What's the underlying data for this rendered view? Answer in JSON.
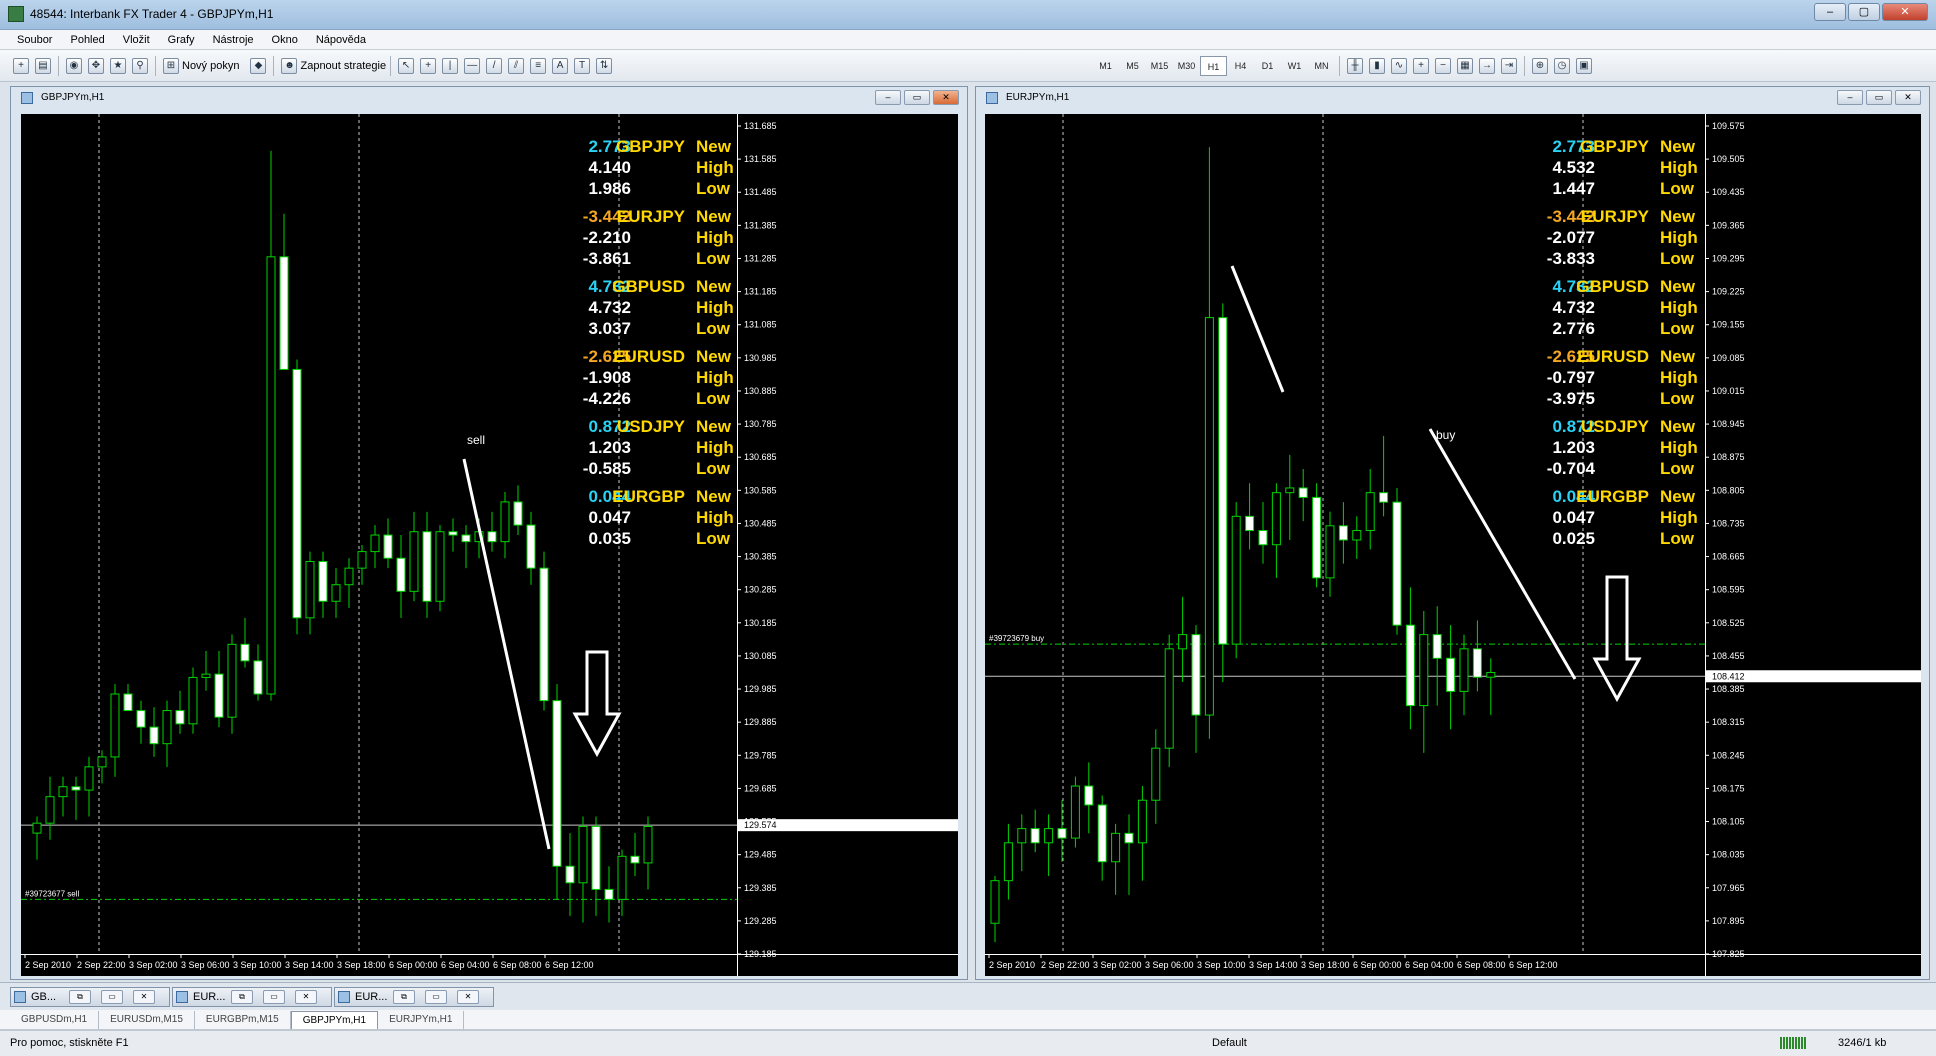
{
  "window": {
    "title": "48544: Interbank FX Trader 4 - GBPJPYm,H1",
    "min": "–",
    "max": "▢",
    "close": "✕"
  },
  "menu": [
    "Soubor",
    "Pohled",
    "Vložit",
    "Grafy",
    "Nástroje",
    "Okno",
    "Nápověda"
  ],
  "toolbar": {
    "new_order": "Nový pokyn",
    "expert": "Zapnout strategie",
    "timeframes": [
      "M1",
      "M5",
      "M15",
      "M30",
      "H1",
      "H4",
      "D1",
      "W1",
      "MN"
    ],
    "letter_tools": [
      "A",
      "T"
    ]
  },
  "icons": [
    "new-chart-icon",
    "profiles-icon",
    "market-watch-icon",
    "navigator-icon",
    "terminal-icon",
    "tester-icon",
    "new-order-icon",
    "expert-icon",
    "cursor-icon",
    "crosshair-icon",
    "vertical-line-icon",
    "horizontal-line-icon",
    "trendline-icon",
    "channel-icon",
    "fibonacci-icon",
    "text-icon",
    "label-icon",
    "arrows-icon",
    "bar-chart-icon",
    "candle-chart-icon",
    "line-chart-icon",
    "zoom-in-icon",
    "zoom-out-icon",
    "tile-icon",
    "autoscroll-icon",
    "shift-icon",
    "indicators-icon",
    "periods-icon",
    "templates-icon"
  ],
  "colors": {
    "bull": "#00d400",
    "bull_body": "#000000",
    "bear_body": "#ffffff",
    "grid": "#c8c8c8",
    "indicator_pos": "#29d3f5",
    "indicator_neg": "#f5a623",
    "symbol": "#ffd800",
    "row_white": "#ffffff"
  },
  "chart_windows": [
    {
      "title": "GBPJPYm,H1",
      "order_label": "#39723677 sell",
      "annotation": "sell",
      "current_price": "129.574",
      "indicator": [
        {
          "symbol": "GBPJPY",
          "new": "2.773",
          "high": "4.140",
          "low": "1.986",
          "new_positive": true
        },
        {
          "symbol": "EURJPY",
          "new": "-3.442",
          "high": "-2.210",
          "low": "-3.861",
          "new_positive": false
        },
        {
          "symbol": "GBPUSD",
          "new": "4.732",
          "high": "4.732",
          "low": "3.037",
          "new_positive": true
        },
        {
          "symbol": "EURUSD",
          "new": "-2.625",
          "high": "-1.908",
          "low": "-4.226",
          "new_positive": false
        },
        {
          "symbol": "USDJPY",
          "new": "0.872",
          "high": "1.203",
          "low": "-0.585",
          "new_positive": true
        },
        {
          "symbol": "EURGBP",
          "new": "0.044",
          "high": "0.047",
          "low": "0.035",
          "new_positive": true
        }
      ],
      "labels": {
        "new": "New",
        "high": "High",
        "low": "Low"
      },
      "chart_data": {
        "type": "candlestick",
        "symbol": "GBPJPYm",
        "timeframe": "H1",
        "ylim": [
          129.185,
          131.685
        ],
        "step": 0.1,
        "y_ticks": [
          "131.685",
          "131.585",
          "131.485",
          "131.385",
          "131.285",
          "131.185",
          "131.085",
          "130.985",
          "130.885",
          "130.785",
          "130.685",
          "130.585",
          "130.485",
          "130.385",
          "130.285",
          "130.185",
          "130.085",
          "129.985",
          "129.885",
          "129.785",
          "129.685",
          "129.585",
          "129.485",
          "129.385",
          "129.285",
          "129.185"
        ],
        "x_labels": [
          "2 Sep 2010",
          "2 Sep 22:00",
          "3 Sep 02:00",
          "3 Sep 06:00",
          "3 Sep 10:00",
          "3 Sep 14:00",
          "3 Sep 18:00",
          "6 Sep 00:00",
          "6 Sep 04:00",
          "6 Sep 08:00",
          "6 Sep 12:00"
        ],
        "current_price": 129.574,
        "order_price": 129.35,
        "candles": [
          [
            129.55,
            129.6,
            129.47,
            129.58
          ],
          [
            129.58,
            129.72,
            129.53,
            129.66
          ],
          [
            129.66,
            129.72,
            129.6,
            129.69
          ],
          [
            129.69,
            129.72,
            129.59,
            129.68
          ],
          [
            129.68,
            129.78,
            129.6,
            129.75
          ],
          [
            129.75,
            129.8,
            129.7,
            129.78
          ],
          [
            129.78,
            130.0,
            129.72,
            129.97
          ],
          [
            129.97,
            130.0,
            129.92,
            129.92
          ],
          [
            129.92,
            129.95,
            129.82,
            129.87
          ],
          [
            129.87,
            129.93,
            129.78,
            129.82
          ],
          [
            129.82,
            129.95,
            129.75,
            129.92
          ],
          [
            129.92,
            129.98,
            129.85,
            129.88
          ],
          [
            129.88,
            130.05,
            129.85,
            130.02
          ],
          [
            130.02,
            130.1,
            129.98,
            130.03
          ],
          [
            130.03,
            130.1,
            129.87,
            129.9
          ],
          [
            129.9,
            130.15,
            129.85,
            130.12
          ],
          [
            130.12,
            130.2,
            130.05,
            130.07
          ],
          [
            130.07,
            130.12,
            129.95,
            129.97
          ],
          [
            129.97,
            131.61,
            129.95,
            131.29
          ],
          [
            131.29,
            131.42,
            131.08,
            130.95
          ],
          [
            130.95,
            130.98,
            130.15,
            130.2
          ],
          [
            130.2,
            130.4,
            130.15,
            130.37
          ],
          [
            130.37,
            130.4,
            130.2,
            130.25
          ],
          [
            130.25,
            130.35,
            130.2,
            130.3
          ],
          [
            130.3,
            130.38,
            130.23,
            130.35
          ],
          [
            130.35,
            130.42,
            130.3,
            130.4
          ],
          [
            130.4,
            130.48,
            130.35,
            130.45
          ],
          [
            130.45,
            130.5,
            130.35,
            130.38
          ],
          [
            130.38,
            130.45,
            130.2,
            130.28
          ],
          [
            130.28,
            130.52,
            130.25,
            130.46
          ],
          [
            130.46,
            130.52,
            130.2,
            130.25
          ],
          [
            130.25,
            130.48,
            130.22,
            130.46
          ],
          [
            130.46,
            130.5,
            130.4,
            130.45
          ],
          [
            130.45,
            130.48,
            130.35,
            130.43
          ],
          [
            130.43,
            130.5,
            130.38,
            130.46
          ],
          [
            130.46,
            130.52,
            130.4,
            130.43
          ],
          [
            130.43,
            130.58,
            130.38,
            130.55
          ],
          [
            130.55,
            130.6,
            130.45,
            130.48
          ],
          [
            130.48,
            130.52,
            130.3,
            130.35
          ],
          [
            130.35,
            130.4,
            129.92,
            129.95
          ],
          [
            129.95,
            130.0,
            129.35,
            129.45
          ],
          [
            129.45,
            129.55,
            129.3,
            129.4
          ],
          [
            129.4,
            129.6,
            129.28,
            129.57
          ],
          [
            129.57,
            129.6,
            129.3,
            129.38
          ],
          [
            129.38,
            129.45,
            129.28,
            129.35
          ],
          [
            129.35,
            129.5,
            129.3,
            129.48
          ],
          [
            129.48,
            129.55,
            129.42,
            129.46
          ],
          [
            129.46,
            129.6,
            129.38,
            129.57
          ]
        ]
      }
    },
    {
      "title": "EURJPYm,H1",
      "order_label": "#39723679 buy",
      "annotation": "buy",
      "current_price": "108.412",
      "indicator": [
        {
          "symbol": "GBPJPY",
          "new": "2.773",
          "high": "4.532",
          "low": "1.447",
          "new_positive": true
        },
        {
          "symbol": "EURJPY",
          "new": "-3.442",
          "high": "-2.077",
          "low": "-3.833",
          "new_positive": false
        },
        {
          "symbol": "GBPUSD",
          "new": "4.732",
          "high": "4.732",
          "low": "2.776",
          "new_positive": true
        },
        {
          "symbol": "EURUSD",
          "new": "-2.625",
          "high": "-0.797",
          "low": "-3.975",
          "new_positive": false
        },
        {
          "symbol": "USDJPY",
          "new": "0.872",
          "high": "1.203",
          "low": "-0.704",
          "new_positive": true
        },
        {
          "symbol": "EURGBP",
          "new": "0.044",
          "high": "0.047",
          "low": "0.025",
          "new_positive": true
        }
      ],
      "labels": {
        "new": "New",
        "high": "High",
        "low": "Low"
      },
      "chart_data": {
        "type": "candlestick",
        "symbol": "EURJPYm",
        "timeframe": "H1",
        "ylim": [
          107.825,
          109.575
        ],
        "step": 0.07,
        "y_ticks": [
          "109.575",
          "109.505",
          "109.435",
          "109.365",
          "109.295",
          "109.225",
          "109.155",
          "109.085",
          "109.015",
          "108.945",
          "108.875",
          "108.805",
          "108.735",
          "108.665",
          "108.595",
          "108.525",
          "108.455",
          "108.385",
          "108.315",
          "108.245",
          "108.175",
          "108.105",
          "108.035",
          "107.965",
          "107.895",
          "107.825"
        ],
        "x_labels": [
          "2 Sep 2010",
          "2 Sep 22:00",
          "3 Sep 02:00",
          "3 Sep 06:00",
          "3 Sep 10:00",
          "3 Sep 14:00",
          "3 Sep 18:00",
          "6 Sep 00:00",
          "6 Sep 04:00",
          "6 Sep 08:00",
          "6 Sep 12:00"
        ],
        "current_price": 108.412,
        "order_price": 108.48,
        "candles": [
          [
            107.89,
            107.99,
            107.85,
            107.98
          ],
          [
            107.98,
            108.1,
            107.94,
            108.06
          ],
          [
            108.06,
            108.12,
            108.0,
            108.09
          ],
          [
            108.09,
            108.13,
            108.04,
            108.06
          ],
          [
            108.06,
            108.12,
            107.99,
            108.09
          ],
          [
            108.09,
            108.15,
            108.02,
            108.07
          ],
          [
            108.07,
            108.2,
            108.05,
            108.18
          ],
          [
            108.18,
            108.23,
            108.08,
            108.14
          ],
          [
            108.14,
            108.16,
            107.98,
            108.02
          ],
          [
            108.02,
            108.1,
            107.95,
            108.08
          ],
          [
            108.08,
            108.12,
            107.95,
            108.06
          ],
          [
            108.06,
            108.18,
            107.98,
            108.15
          ],
          [
            108.15,
            108.3,
            108.1,
            108.26
          ],
          [
            108.26,
            108.5,
            108.22,
            108.47
          ],
          [
            108.47,
            108.58,
            108.4,
            108.5
          ],
          [
            108.5,
            108.52,
            108.25,
            108.33
          ],
          [
            108.33,
            109.53,
            108.28,
            109.17
          ],
          [
            109.17,
            109.2,
            108.4,
            108.48
          ],
          [
            108.48,
            108.78,
            108.45,
            108.75
          ],
          [
            108.75,
            108.82,
            108.68,
            108.72
          ],
          [
            108.72,
            108.78,
            108.65,
            108.69
          ],
          [
            108.69,
            108.82,
            108.62,
            108.8
          ],
          [
            108.8,
            108.88,
            108.7,
            108.81
          ],
          [
            108.81,
            108.85,
            108.74,
            108.79
          ],
          [
            108.79,
            108.82,
            108.6,
            108.62
          ],
          [
            108.62,
            108.76,
            108.58,
            108.73
          ],
          [
            108.73,
            108.78,
            108.65,
            108.7
          ],
          [
            108.7,
            108.75,
            108.66,
            108.72
          ],
          [
            108.72,
            108.85,
            108.68,
            108.8
          ],
          [
            108.8,
            108.92,
            108.75,
            108.78
          ],
          [
            108.78,
            108.81,
            108.5,
            108.52
          ],
          [
            108.52,
            108.6,
            108.3,
            108.35
          ],
          [
            108.35,
            108.55,
            108.25,
            108.5
          ],
          [
            108.5,
            108.56,
            108.35,
            108.45
          ],
          [
            108.45,
            108.52,
            108.3,
            108.38
          ],
          [
            108.38,
            108.5,
            108.33,
            108.47
          ],
          [
            108.47,
            108.53,
            108.38,
            108.41
          ],
          [
            108.41,
            108.45,
            108.33,
            108.42
          ]
        ]
      }
    }
  ],
  "mdi_tabs": [
    "GB...",
    "EUR...",
    "EUR..."
  ],
  "chart_tabs": [
    "GBPUSDm,H1",
    "EURUSDm,M15",
    "EURGBPm,M15",
    "GBPJPYm,H1",
    "EURJPYm,H1"
  ],
  "active_tab": "GBPJPYm,H1",
  "status": {
    "help": "Pro pomoc, stiskněte F1",
    "profile": "Default",
    "traffic": "3246/1 kb"
  }
}
